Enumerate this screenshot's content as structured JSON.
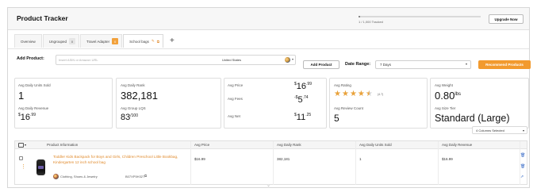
{
  "header": {
    "title": "Product Tracker",
    "progress_label": "1 / 1,000 Tracked",
    "progress_fraction": 0.001,
    "upgrade_label": "Upgrade Now"
  },
  "tabs": [
    {
      "label": "Overview",
      "count": null
    },
    {
      "label": "Ungrouped",
      "count": "0"
    },
    {
      "label": "Travel Adapter",
      "count": "0"
    },
    {
      "label": "School bags",
      "count": null,
      "active": true
    }
  ],
  "add_product": {
    "label": "Add Product:",
    "placeholder": "Insert ASIN or Amazon URL",
    "market": "United States",
    "add_button": "Add Product"
  },
  "date_range": {
    "label": "Date Range:",
    "value": "7 Days"
  },
  "recommend_button": "Recommend Products",
  "stats": {
    "units_sold_label": "Avg Daily Units Sold",
    "units_sold": "1",
    "revenue_label": "Avg Daily Revenue",
    "revenue_dollars": "16",
    "revenue_cents": ".99",
    "bsr_label": "Avg Daily Rank",
    "bsr": "382,181",
    "group_lqs_label": "Avg Group LQS",
    "group_lqs": "83",
    "group_lqs_max": "/100",
    "price_label": "Avg Price",
    "price_dollars": "16",
    "price_cents": ".99",
    "fees_label": "Avg Fees",
    "fees_dollars": "5",
    "fees_cents": ".74",
    "net_label": "Avg Net",
    "net_dollars": "11",
    "net_cents": ".25",
    "rating_label": "Avg Rating",
    "rating_value": 4.7,
    "rating_text": "(4.7)",
    "review_count_label": "Avg Review Count",
    "review_count": "5",
    "weight_label": "Avg Weight",
    "weight": "0.80",
    "weight_unit": "lbs",
    "size_tier_label": "Avg Size Tier",
    "size_tier": "Standard (Large)"
  },
  "columns_selector": "4 Columns Selected",
  "table": {
    "headers": [
      "Product Information",
      "Avg Price",
      "Avg Daily Rank",
      "Avg Daily Units Sold",
      "Avg Daily Revenue"
    ],
    "rows": [
      {
        "name": "Toddler Kids Backpack for Boys and Girls, Children Preschool Little Bookbag, Kindergarten 12 inch school bag",
        "category": "Clothing, Shoes & Jewelry",
        "asin": "B07XP5H32T",
        "price": "$16.99",
        "rank": "382,181",
        "units": "1",
        "revenue": "$16.99"
      }
    ]
  },
  "colors": {
    "accent": "#f29a2e",
    "link": "#e08a2c",
    "star": "#e9a23b"
  }
}
